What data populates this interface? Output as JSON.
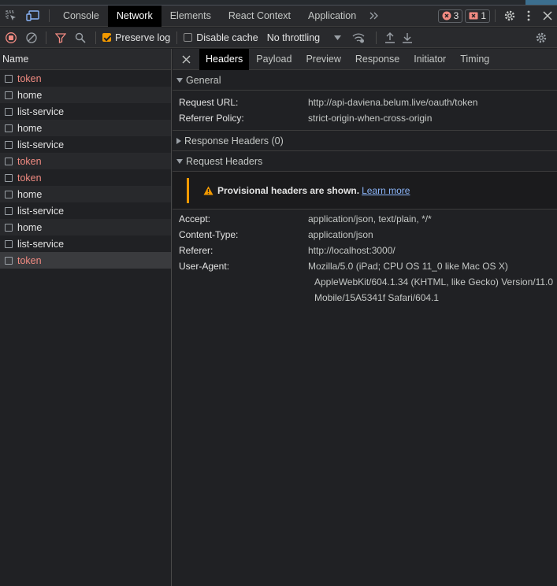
{
  "toptabs": [
    {
      "label": "Console",
      "active": false
    },
    {
      "label": "Network",
      "active": true
    },
    {
      "label": "Elements",
      "active": false
    },
    {
      "label": "React Context",
      "active": false
    },
    {
      "label": "Application",
      "active": false
    }
  ],
  "badges": {
    "errors": "3",
    "issues": "1"
  },
  "toolbar": {
    "preserve_log": "Preserve log",
    "disable_cache": "Disable cache",
    "throttling": "No throttling"
  },
  "requests": {
    "header": "Name",
    "rows": [
      {
        "name": "token",
        "error": true
      },
      {
        "name": "home",
        "error": false
      },
      {
        "name": "list-service",
        "error": false
      },
      {
        "name": "home",
        "error": false
      },
      {
        "name": "list-service",
        "error": false
      },
      {
        "name": "token",
        "error": true
      },
      {
        "name": "token",
        "error": true
      },
      {
        "name": "home",
        "error": false
      },
      {
        "name": "list-service",
        "error": false
      },
      {
        "name": "home",
        "error": false
      },
      {
        "name": "list-service",
        "error": false
      },
      {
        "name": "token",
        "error": true,
        "selected": true
      }
    ]
  },
  "detail_tabs": [
    "Headers",
    "Payload",
    "Preview",
    "Response",
    "Initiator",
    "Timing"
  ],
  "general": {
    "title": "General",
    "request_url_label": "Request URL:",
    "request_url": "http://api-daviena.belum.live/oauth/token",
    "referrer_policy_label": "Referrer Policy:",
    "referrer_policy": "strict-origin-when-cross-origin"
  },
  "response_headers": {
    "title": "Response Headers (0)"
  },
  "request_headers": {
    "title": "Request Headers",
    "warning": "Provisional headers are shown.",
    "learn_more": "Learn more",
    "accept_label": "Accept:",
    "accept": "application/json, text/plain, */*",
    "content_type_label": "Content-Type:",
    "content_type": "application/json",
    "referer_label": "Referer:",
    "referer": "http://localhost:3000/",
    "user_agent_label": "User-Agent:",
    "user_agent_1": "Mozilla/5.0 (iPad; CPU OS 11_0 like Mac OS X)",
    "user_agent_2": "AppleWebKit/604.1.34 (KHTML, like Gecko) Version/11.0",
    "user_agent_3": "Mobile/15A5341f Safari/604.1"
  },
  "colors": {
    "error": "#f28b82",
    "accent": "#f29900",
    "link": "#8ab4f8"
  }
}
